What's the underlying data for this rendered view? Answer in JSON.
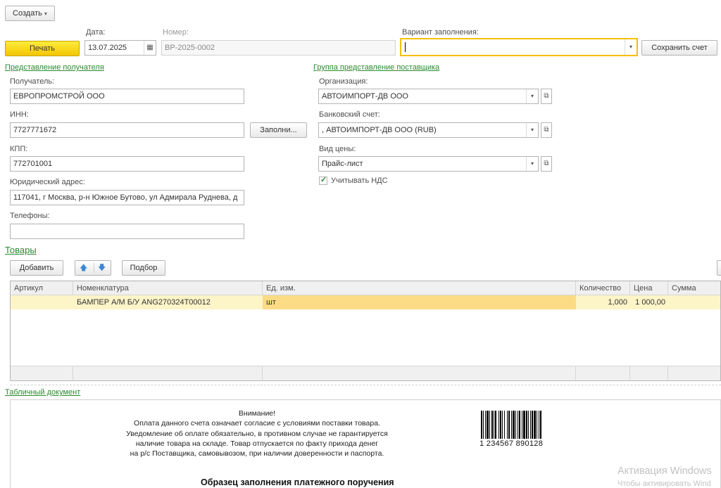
{
  "toolbar": {
    "create_label": "Создать",
    "create_arrow": "▾"
  },
  "header": {
    "print_label": "Печать",
    "date_label": "Дата:",
    "date_value": "13.07.2025",
    "number_label": "Номер:",
    "number_value": "ВР-2025-0002",
    "fill_variant_label": "Вариант заполнения:",
    "fill_variant_value": "",
    "save_account_label": "Сохранить счет"
  },
  "recipient": {
    "section_title": "Представление получателя",
    "recipient_label": "Получатель:",
    "recipient_value": "ЕВРОПРОМСТРОЙ ООО",
    "inn_label": "ИНН:",
    "inn_value": "7727771672",
    "fill_button": "Заполни...",
    "kpp_label": "КПП:",
    "kpp_value": "772701001",
    "address_label": "Юридический адрес:",
    "address_value": "117041, г Москва, р-н Южное Бутово, ул Адмирала Руднева, д",
    "phones_label": "Телефоны:",
    "phones_value": ""
  },
  "supplier": {
    "section_title": "Группа представление поставщика",
    "org_label": "Организация:",
    "org_value": "АВТОИМПОРТ-ДВ ООО",
    "bank_label": "Банковский счет:",
    "bank_value": ", АВТОИМПОРТ-ДВ ООО (RUB)",
    "price_label": "Вид цены:",
    "price_value": "Прайс-лист",
    "vat_label": "Учитывать НДС",
    "vat_checked": true
  },
  "goods": {
    "section_title": "Товары",
    "add_label": "Добавить",
    "pick_label": "Подбор",
    "columns": [
      "Артикул",
      "Номенклатура",
      "Ед. изм.",
      "Количество",
      "Цена",
      "Сумма"
    ],
    "rows": [
      {
        "article": "",
        "name": "БАМПЕР А/М Б/У ANG270324T00012",
        "unit": "шт",
        "qty": "1,000",
        "price": "1 000,00",
        "sum": ""
      }
    ]
  },
  "doc": {
    "section_title": "Табличный документ",
    "notice_lines": [
      "Внимание!",
      "Оплата данного счета означает согласие с условиями поставки товара.",
      "Уведомление об оплате обязательно, в противном случае не гарантируется",
      "наличие товара на складе. Товар отпускается по факту прихода денег",
      "на р/с Поставщика, самовывозом, при наличии доверенности и паспорта."
    ],
    "barcode_digits": "1 234567 890128",
    "form_title": "Образец заполнения платежного поручения"
  },
  "watermark": {
    "line1": "Активация Windows",
    "line2": "Чтобы активировать Wind"
  }
}
